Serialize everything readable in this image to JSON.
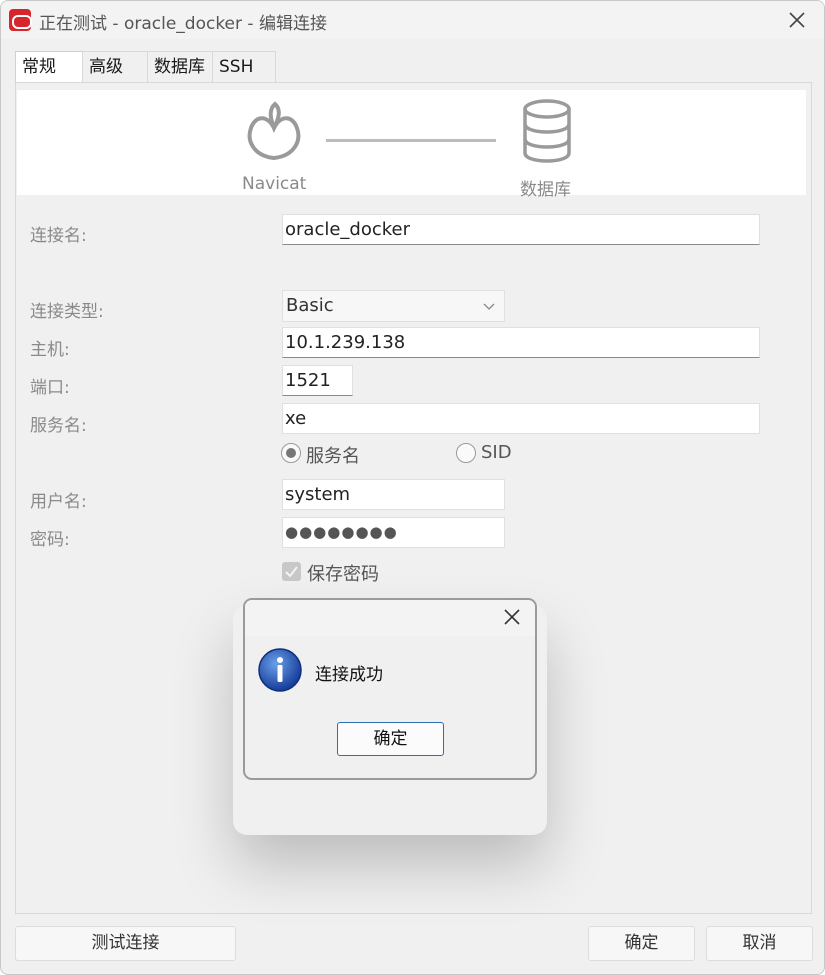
{
  "window": {
    "title": "正在测试 - oracle_docker - 编辑连接"
  },
  "tabs": [
    {
      "label": "常规",
      "active": true
    },
    {
      "label": "高级",
      "active": false
    },
    {
      "label": "数据库",
      "active": false
    },
    {
      "label": "SSH",
      "active": false
    }
  ],
  "banner": {
    "left_label": "Navicat",
    "right_label": "数据库",
    "left_icon": "navicat-icon",
    "right_icon": "database-icon"
  },
  "form": {
    "connection_name": {
      "label": "连接名:",
      "value": "oracle_docker"
    },
    "connection_type": {
      "label": "连接类型:",
      "value": "Basic"
    },
    "host": {
      "label": "主机:",
      "value": "10.1.239.138"
    },
    "port": {
      "label": "端口:",
      "value": "1521"
    },
    "service_name": {
      "label": "服务名:",
      "value": "xe"
    },
    "service_mode": {
      "option_service": "服务名",
      "option_sid": "SID",
      "selected": "服务名"
    },
    "username": {
      "label": "用户名:",
      "value": "system"
    },
    "password": {
      "label": "密码:",
      "value": "●●●●●●●●"
    },
    "save_password": {
      "label": "保存密码",
      "checked": true
    }
  },
  "buttons": {
    "test": "测试连接",
    "ok": "确定",
    "cancel": "取消"
  },
  "dialog": {
    "message": "连接成功",
    "ok": "确定"
  },
  "colors": {
    "brand": "#d6262b",
    "dialog_accent": "#2c6fb0"
  }
}
